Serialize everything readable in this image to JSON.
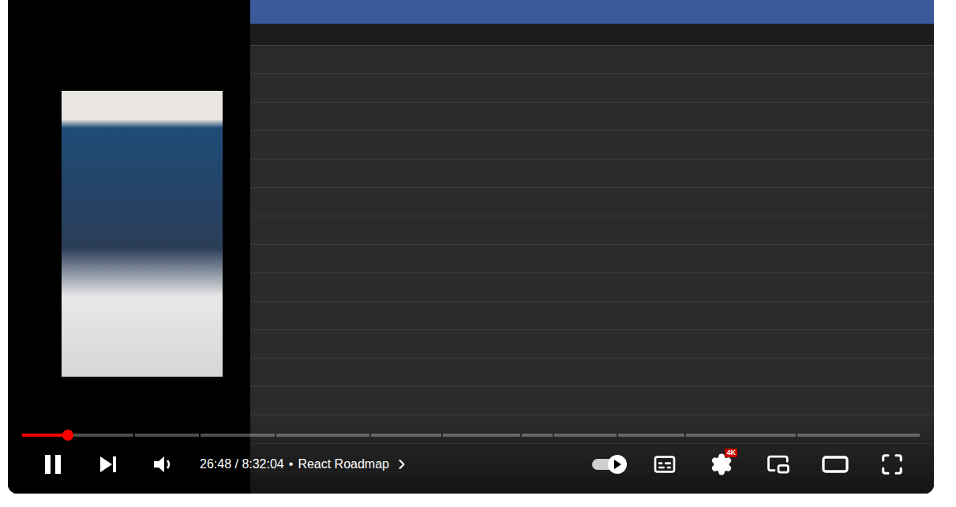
{
  "player": {
    "playing": true,
    "progress": {
      "level": 0.051,
      "chapters": [
        144,
        82,
        96,
        120,
        90,
        100,
        40,
        80,
        86,
        141,
        158
      ]
    },
    "time": "26:48 / 8:32:04",
    "separator": "•",
    "chapter_title": "React Roadmap",
    "autoplay": {
      "on": true
    },
    "captions": {
      "on": false
    },
    "quality_badge": "4K"
  }
}
